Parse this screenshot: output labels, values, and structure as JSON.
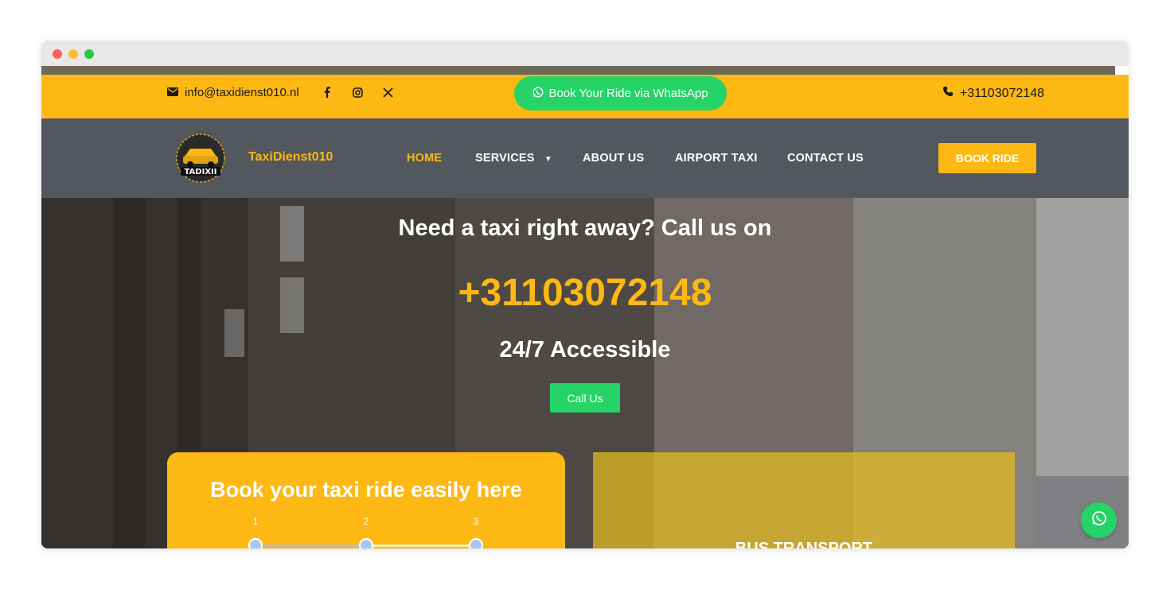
{
  "topbar": {
    "email": "info@taxidienst010.nl",
    "social_icons": [
      "facebook-icon",
      "instagram-icon",
      "x-icon"
    ],
    "whatsapp_label": "Book Your Ride via WhatsApp",
    "phone": "+31103072148"
  },
  "nav": {
    "logo_text": "TADIXII",
    "brand": "TaxiDienst010",
    "items": [
      {
        "label": "HOME",
        "active": true
      },
      {
        "label": "SERVICES",
        "dropdown": true
      },
      {
        "label": "ABOUT US"
      },
      {
        "label": "AIRPORT TAXI"
      },
      {
        "label": "CONTACT US"
      }
    ],
    "cta": "BOOK RIDE"
  },
  "hero": {
    "title": "Need a taxi right away? Call us on",
    "phone": "+31103072148",
    "subtitle": "24/7 Accessible",
    "call_button": "Call Us"
  },
  "booking": {
    "title": "Book your taxi ride easily here",
    "steps": [
      "1",
      "2",
      "3"
    ]
  },
  "bus_card": {
    "title": "BUS TRANSPORT"
  },
  "colors": {
    "accent": "#fdb813",
    "whatsapp": "#25d366",
    "navbar": "#53575e"
  }
}
